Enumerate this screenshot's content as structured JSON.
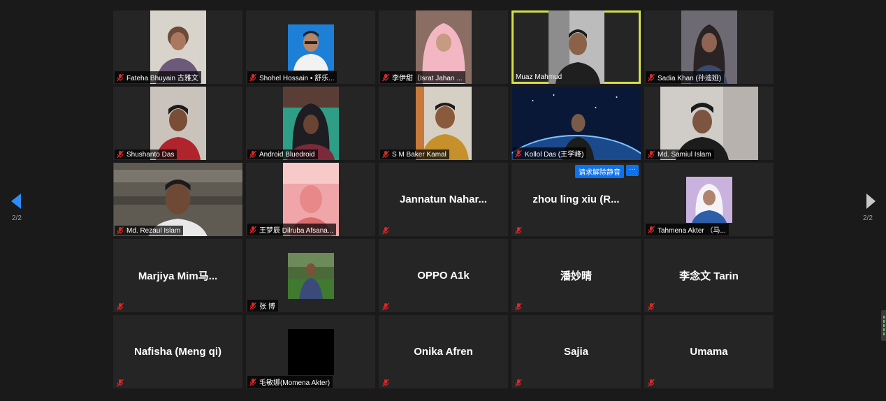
{
  "navigation": {
    "page_indicator_left": "2/2",
    "page_indicator_right": "2/2"
  },
  "colors": {
    "background": "#1a1a1a",
    "tile": "#252525",
    "active_speaker_border": "#d4e04a",
    "mute_icon": "#e02828",
    "action_button": "#0e72ed"
  },
  "participants": [
    {
      "name": "Fateha Bhuyain 古雅文"
    },
    {
      "name": "Shohel Hossain • 舒乐..."
    },
    {
      "name": "李伊甜（Israt Jahan ..."
    },
    {
      "name": "Muaz Mahmud"
    },
    {
      "name": "Sadia Khan (孙迪娅)"
    },
    {
      "name": "Shushanto Das"
    },
    {
      "name": "Android Bluedroid"
    },
    {
      "name": "S M Baker Kamal"
    },
    {
      "name": "Kollol Das (王学峰)"
    },
    {
      "name": "Md. Samiul Islam"
    },
    {
      "name": "Md. Rezaul Islam"
    },
    {
      "name": "王梦辰 Dilruba Afsana..."
    },
    {
      "name": "Jannatun  Nahar..."
    },
    {
      "name": "zhou ling xiu (R...",
      "request_unmute_label": "请求解除静音",
      "more_label": "···"
    },
    {
      "name": "Tahmena Akter （马..."
    },
    {
      "name": "Marjiya  Mim马..."
    },
    {
      "name": "张 博"
    },
    {
      "name": "OPPO A1k"
    },
    {
      "name": "潘妙晴"
    },
    {
      "name": "李念文 Tarin"
    },
    {
      "name": "Nafisha (Meng qi)"
    },
    {
      "name": "毛敏娜(Momena Akter)"
    },
    {
      "name": "Onika Afren"
    },
    {
      "name": "Sajia"
    },
    {
      "name": "Umama"
    }
  ]
}
